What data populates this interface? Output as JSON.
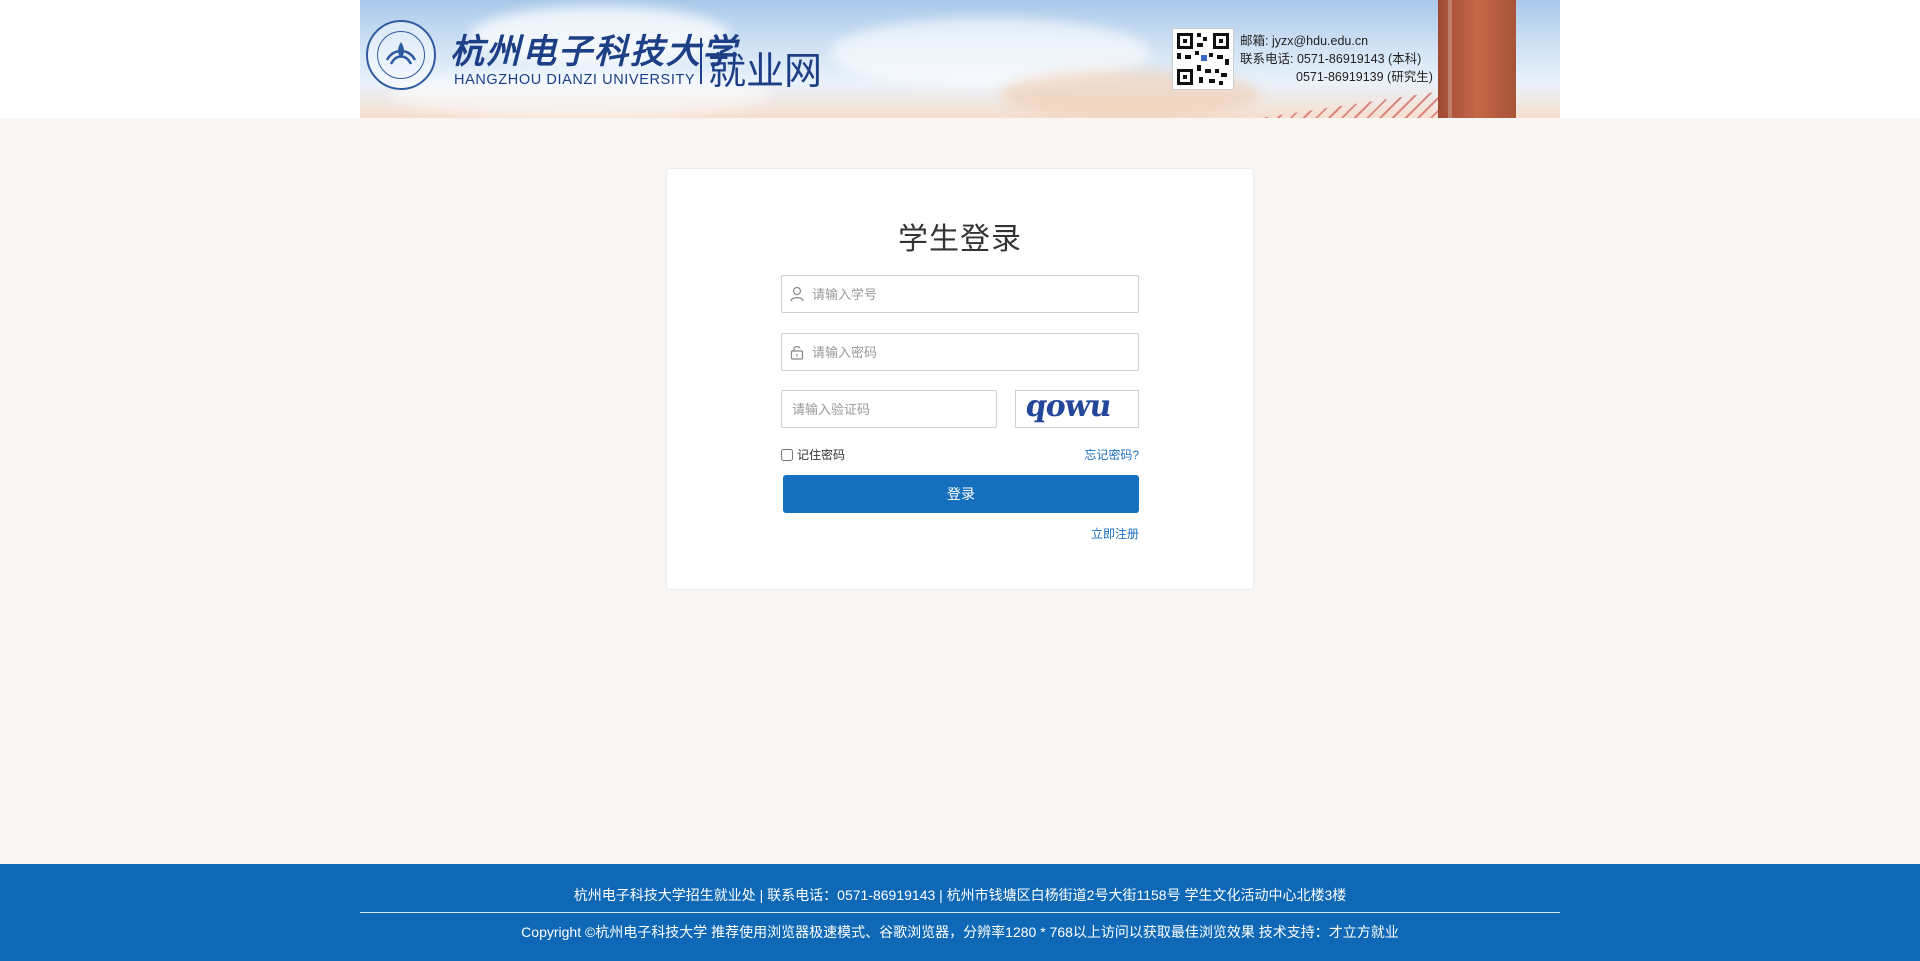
{
  "header": {
    "university_name_cn": "杭州电子科技大学",
    "university_name_en": "HANGZHOU DIANZI UNIVERSITY",
    "site_name": "就业网",
    "email_label": "邮箱: jyzx@hdu.edu.cn",
    "phone_label": "联系电话: 0571-86919143 (本科)",
    "phone_label_2": "0571-86919139 (研究生)",
    "logo_icon": "university-seal-icon",
    "qr_icon": "qr-code-icon"
  },
  "login": {
    "title": "学生登录",
    "username_placeholder": "请输入学号",
    "password_placeholder": "请输入密码",
    "captcha_placeholder": "请输入验证码",
    "captcha_text": "qowu",
    "remember_label": "记住密码",
    "forgot_label": "忘记密码?",
    "login_button": "登录",
    "register_label": "立即注册",
    "accent_color": "#1670be"
  },
  "footer": {
    "line1": "杭州电子科技大学招生就业处 | 联系电话：0571-86919143 | 杭州市钱塘区白杨街道2号大街1158号 学生文化活动中心北楼3楼",
    "line2": "Copyright ©杭州电子科技大学  推荐使用浏览器极速模式、谷歌浏览器，分辨率1280 * 768以上访问以获取最佳浏览效果  技术支持：才立方就业",
    "background_color": "#0e68b6"
  }
}
